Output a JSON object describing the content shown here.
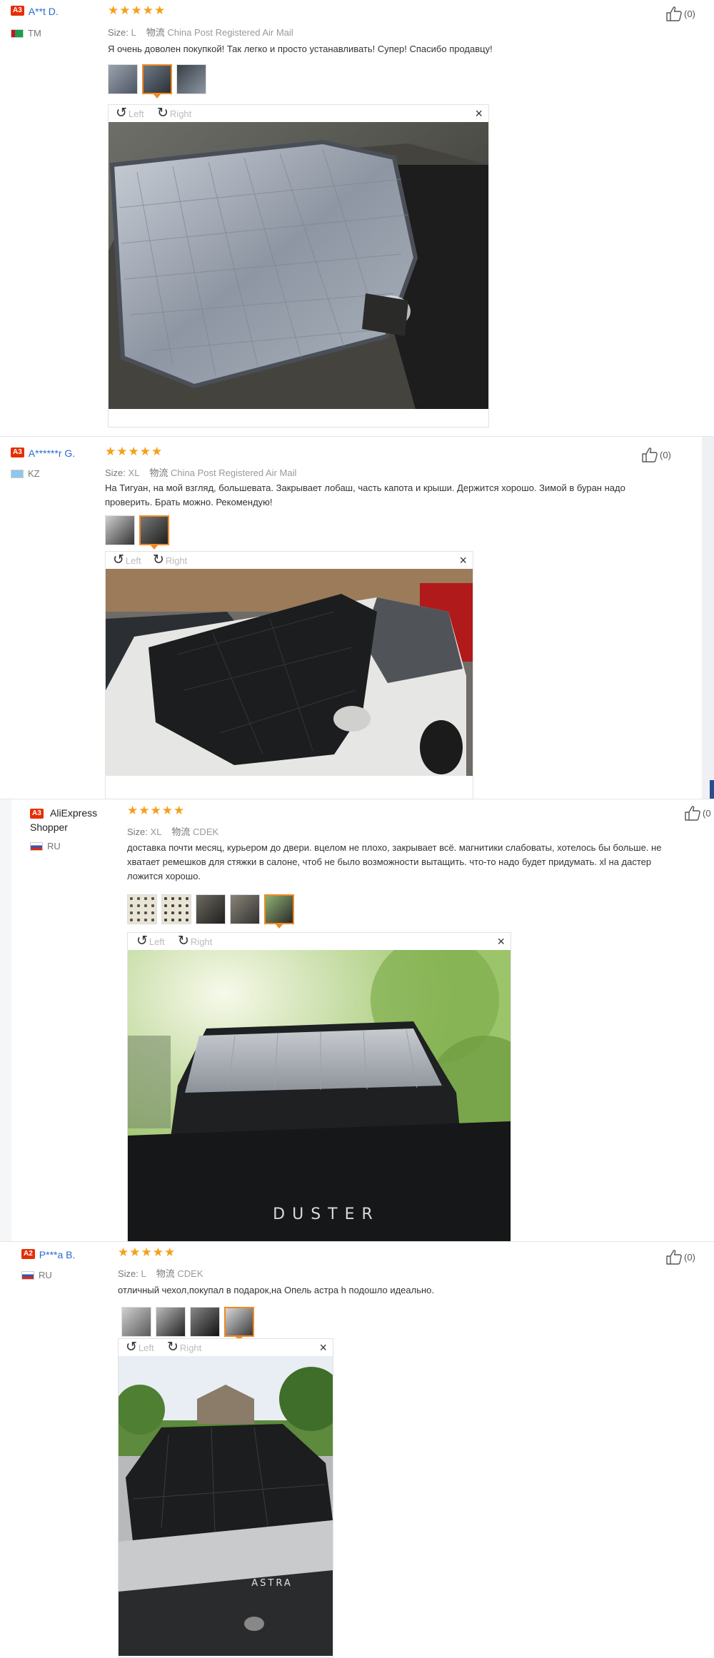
{
  "labels": {
    "size_key": "Size:",
    "shipping_key": "物流",
    "left": "Left",
    "right": "Right",
    "close": "×"
  },
  "colors": {
    "star": "#f4a019",
    "username": "#2a6ad1",
    "badge": "#e62e04",
    "selected_thumb": "#f08a24"
  },
  "reviews": [
    {
      "badge": "A3",
      "username": "A**t D.",
      "country": "TM",
      "rating": 5,
      "stars": "★★★★★",
      "size": "L",
      "shipping": "China Post Registered Air Mail",
      "text": "Я очень доволен покупкой! Так легко и просто устанавливать! Супер! Спасибо продавцу!",
      "likes": "(0)",
      "thumb_count": 3,
      "selected_thumb": 2,
      "photo_alt": "silver car windshield cover"
    },
    {
      "badge": "A3",
      "username": "A******r G.",
      "country": "KZ",
      "rating": 5,
      "stars": "★★★★★",
      "size": "XL",
      "shipping": "China Post Registered Air Mail",
      "text": "На Тигуан, на мой взгляд, большевата. Закрывает лобаш, часть капота и крыши. Держится хорошо. Зимой в буран надо проверить. Брать можно. Рекомендую!",
      "likes": "(0)",
      "thumb_count": 2,
      "selected_thumb": 2,
      "photo_alt": "black cover on white car"
    },
    {
      "badge": "A3",
      "username": "AliExpress Shopper",
      "country": "RU",
      "rating": 5,
      "stars": "★★★★★",
      "size": "XL",
      "shipping": "CDEK",
      "text": "доставка почти месяц, курьером до двери. вцелом не плохо, закрывает всё. магнитики слабоваты, хотелось бы больше. не хватает ремешков для стяжки в салоне, чтоб не было возможности вытащить. что-то надо будет придумать. xl на дастер ложится хорошо.",
      "likes": "(0",
      "thumb_count": 5,
      "selected_thumb": 5,
      "photo_alt": "cover on dark car under trees",
      "hood_text": "DUSTER"
    },
    {
      "badge": "A2",
      "username": "P***a B.",
      "country": "RU",
      "rating": 5,
      "stars": "★★★★★",
      "size": "L",
      "shipping": "CDEK",
      "text": "отличный чехол,покупал в подарок,на Опель астра h подошло идеально.",
      "likes": "(0)",
      "thumb_count": 4,
      "selected_thumb": 4,
      "photo_alt": "black cover on silver car",
      "hood_text": "ASTRA"
    }
  ]
}
